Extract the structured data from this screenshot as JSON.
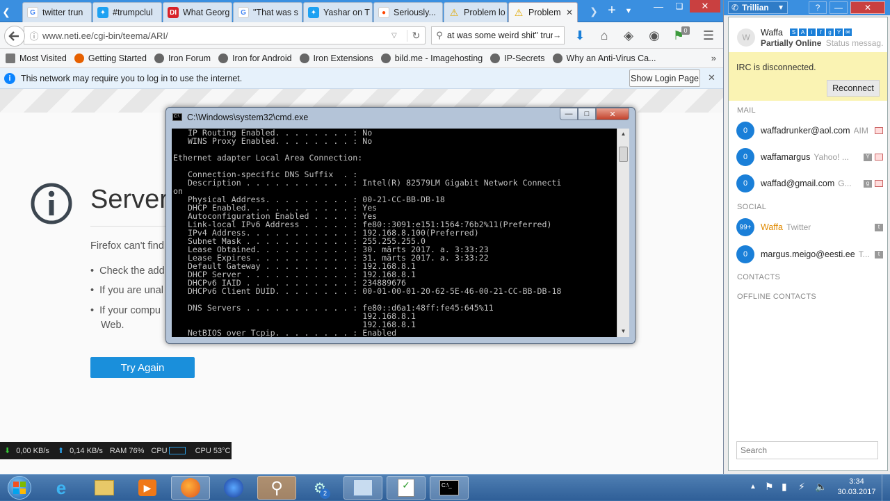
{
  "browser": {
    "tabs": [
      {
        "label": "twitter trun",
        "icon": "google-icon"
      },
      {
        "label": "#trumpclul",
        "icon": "twitter-icon"
      },
      {
        "label": "What Georg",
        "icon": "disqus-icon"
      },
      {
        "label": "\"That was s",
        "icon": "google-icon"
      },
      {
        "label": "Yashar on T",
        "icon": "twitter-icon"
      },
      {
        "label": "Seriously...",
        "icon": "reddit-icon"
      },
      {
        "label": "Problem lo",
        "icon": "warning-icon"
      },
      {
        "label": "Problem",
        "icon": "warning-icon"
      }
    ],
    "url": "www.neti.ee/cgi-bin/teema/ARI/",
    "search_value": "at was some weird shit\" trum",
    "badge_count": "0",
    "bookmarks": [
      "Most Visited",
      "Getting Started",
      "Iron Forum",
      "Iron for Android",
      "Iron Extensions",
      "bild.me - Imagehosting",
      "IP-Secrets",
      "Why an Anti-Virus Ca..."
    ],
    "notification": "This network may require you to log in to use the internet.",
    "show_login_label": "Show Login Page",
    "error": {
      "title": "Server",
      "lead": "Firefox can't find",
      "bullets": [
        "Check the add",
        "If you are unal",
        "If your compu"
      ],
      "bullet3_tail": "Web.",
      "try_again": "Try Again"
    }
  },
  "statusbar": {
    "down": "0,00 KB/s",
    "up": "0,14 KB/s",
    "ram": "RAM 76%",
    "cpu_label": "CPU",
    "cpu_temp": "CPU 53°C"
  },
  "cmd": {
    "title": "C:\\Windows\\system32\\cmd.exe",
    "lines": [
      "   IP Routing Enabled. . . . . . . . : No",
      "   WINS Proxy Enabled. . . . . . . . : No",
      "",
      "Ethernet adapter Local Area Connection:",
      "",
      "   Connection-specific DNS Suffix  . :",
      "   Description . . . . . . . . . . . : Intel(R) 82579LM Gigabit Network Connecti",
      "on",
      "   Physical Address. . . . . . . . . : 00-21-CC-BB-DB-18",
      "   DHCP Enabled. . . . . . . . . . . : Yes",
      "   Autoconfiguration Enabled . . . . : Yes",
      "   Link-local IPv6 Address . . . . . : fe80::3091:e151:1564:76b2%11(Preferred)",
      "   IPv4 Address. . . . . . . . . . . : 192.168.8.100(Preferred)",
      "   Subnet Mask . . . . . . . . . . . : 255.255.255.0",
      "   Lease Obtained. . . . . . . . . . : 30. märts 2017. a. 3:33:23",
      "   Lease Expires . . . . . . . . . . : 31. märts 2017. a. 3:33:22",
      "   Default Gateway . . . . . . . . . : 192.168.8.1",
      "   DHCP Server . . . . . . . . . . . : 192.168.8.1",
      "   DHCPv6 IAID . . . . . . . . . . . : 234889676",
      "   DHCPv6 Client DUID. . . . . . . . : 00-01-00-01-20-62-5E-46-00-21-CC-BB-DB-18",
      "",
      "   DNS Servers . . . . . . . . . . . : fe80::d6a1:48ff:fe45:645%11",
      "                                       192.168.8.1",
      "                                       192.168.8.1",
      "   NetBIOS over Tcpip. . . . . . . . : Enabled"
    ]
  },
  "trillian": {
    "title": "Trillian",
    "user": "Waffa",
    "avatar_letter": "W",
    "status": "Partially Online",
    "status_msg": "Status messag...",
    "irc_msg": "IRC is disconnected.",
    "reconnect": "Reconnect",
    "sections": {
      "mail": "MAIL",
      "social": "SOCIAL",
      "contacts": "CONTACTS",
      "offline": "OFFLINE CONTACTS"
    },
    "mail": [
      {
        "count": "0",
        "name": "waffadrunker@aol.com",
        "sub": "AIM"
      },
      {
        "count": "0",
        "name": "waffamargus",
        "sub": "Yahoo! ..."
      },
      {
        "count": "0",
        "name": "waffad@gmail.com",
        "sub": "G..."
      }
    ],
    "social": [
      {
        "count": "99+",
        "name": "Waffa",
        "sub": "Twitter"
      },
      {
        "count": "0",
        "name": "margus.meigo@eesti.ee",
        "sub": "T..."
      }
    ],
    "search_placeholder": "Search"
  },
  "taskbar": {
    "time": "3:34",
    "date": "30.03.2017",
    "badge": "2"
  },
  "colors": {
    "accent": "#1a7fd8",
    "tab_bar": "#3a8fe0",
    "cmd_bg": "#000000"
  }
}
